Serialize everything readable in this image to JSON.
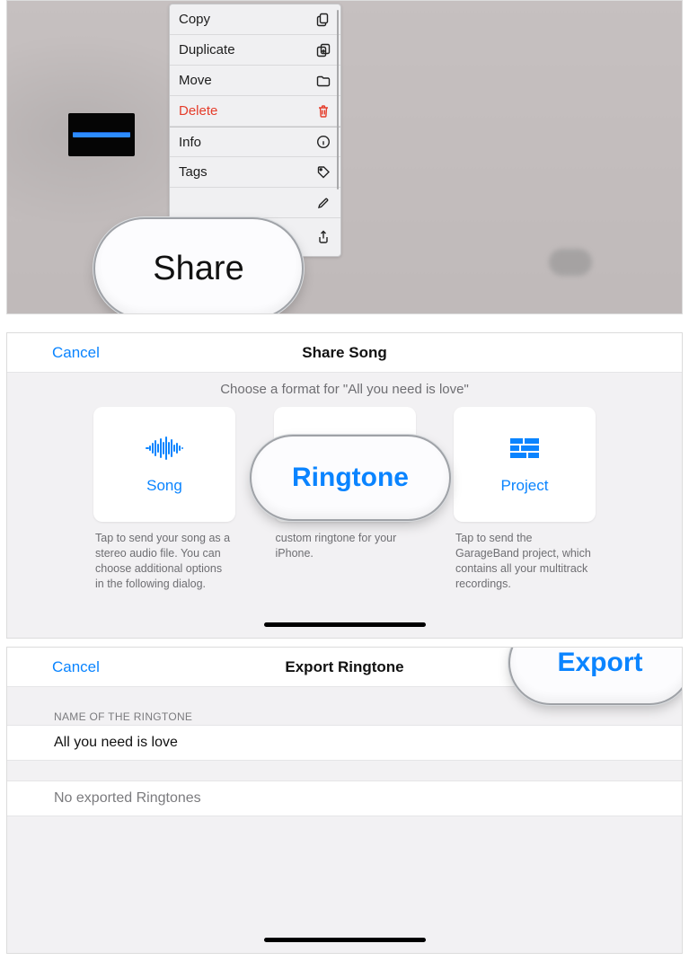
{
  "colors": {
    "accent": "#0a84ff",
    "danger": "#e53c2a"
  },
  "panel1": {
    "context_menu": [
      {
        "label": "Copy",
        "icon": "copy-icon",
        "danger": false
      },
      {
        "label": "Duplicate",
        "icon": "duplicate-icon",
        "danger": false
      },
      {
        "label": "Move",
        "icon": "folder-icon",
        "danger": false
      },
      {
        "label": "Delete",
        "icon": "trash-icon",
        "danger": true
      },
      {
        "label": "Info",
        "icon": "info-icon",
        "danger": false
      },
      {
        "label": "Tags",
        "icon": "tag-icon",
        "danger": false
      },
      {
        "label": "",
        "icon": "pencil-icon",
        "danger": false
      },
      {
        "label": "",
        "icon": "share-icon",
        "danger": false
      }
    ],
    "callout": "Share"
  },
  "panel2": {
    "cancel": "Cancel",
    "title": "Share Song",
    "caption": "Choose a format for \"All you need is love\"",
    "cards": [
      {
        "title": "Song",
        "icon": "waveform-icon",
        "desc": "Tap to send your song as a stereo audio file. You can choose additional options in the following dialog."
      },
      {
        "title": "Ringtone",
        "icon": "bell-icon",
        "desc": "custom ringtone for your iPhone."
      },
      {
        "title": "Project",
        "icon": "bricks-icon",
        "desc": "Tap to send the GarageBand project, which contains all your multitrack recordings."
      }
    ],
    "callout": "Ringtone"
  },
  "panel3": {
    "cancel": "Cancel",
    "title": "Export Ringtone",
    "export": "Export",
    "section_header": "NAME OF THE RINGTONE",
    "name_value": "All you need is love",
    "empty_text": "No exported Ringtones",
    "callout": "Export"
  }
}
